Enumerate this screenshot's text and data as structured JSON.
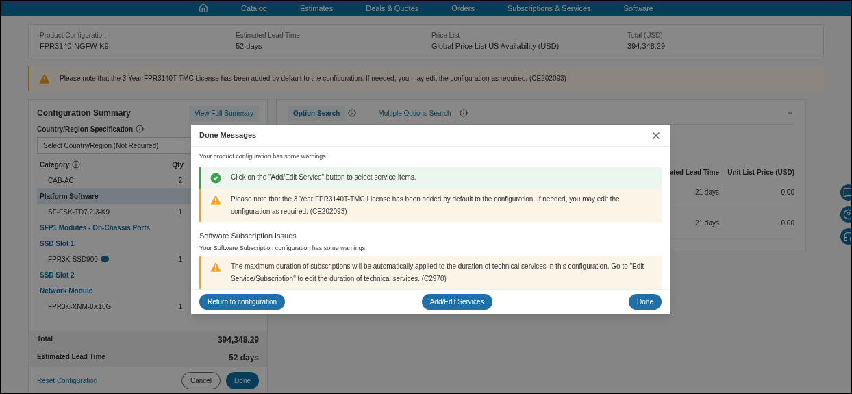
{
  "nav": {
    "items": [
      {
        "kind": "home"
      },
      {
        "kind": "text",
        "label": "Catalog"
      },
      {
        "kind": "text",
        "label": "Estimates"
      },
      {
        "kind": "text",
        "label": "Deals & Quotes"
      },
      {
        "kind": "text",
        "label": "Orders"
      },
      {
        "kind": "text",
        "label": "Subscriptions & Services"
      },
      {
        "kind": "text",
        "label": "Software"
      }
    ]
  },
  "summary_fields": [
    {
      "label": "Product Configuration",
      "value": "FPR3140-NGFW-K9"
    },
    {
      "label": "Estimated Lead Time",
      "value": "52 days"
    },
    {
      "label": "Price List",
      "value": "Global Price List US Availability (USD)"
    },
    {
      "label": "Total (USD)",
      "value": "394,348.29"
    }
  ],
  "banner": {
    "kind": "warning",
    "text": "Please note that the 3 Year FPR3140T-TMC License has been added by default to the configuration. If needed, you may edit the configuration as required. (CE202093)"
  },
  "config_summary": {
    "title": "Configuration Summary",
    "view_link": "View Full Summary",
    "region_label": "Country/Region Specification",
    "region_select": "Select Country/Region (Not Required)",
    "category_header": "Category",
    "qty_header": "Qty",
    "rows": [
      {
        "kind": "item",
        "name": "CAB-AC",
        "qty": "2",
        "badge": false
      },
      {
        "kind": "heading",
        "name": "Platform Software",
        "selected": true
      },
      {
        "kind": "item",
        "name": "SF-FSK-TD7.2.3-K9",
        "qty": "1",
        "badge": false
      },
      {
        "kind": "link",
        "name": "SFP1 Modules - On-Chassis Ports"
      },
      {
        "kind": "link",
        "name": "SSD Slot 1"
      },
      {
        "kind": "item",
        "name": "FPR3K-SSD900",
        "qty": "1",
        "badge": true
      },
      {
        "kind": "link",
        "name": "SSD Slot 2"
      },
      {
        "kind": "link",
        "name": "Network Module"
      },
      {
        "kind": "item",
        "name": "FPR3K-XNM-8X10G",
        "qty": "1",
        "badge": false
      }
    ],
    "total_label": "Total",
    "total_value": "394,348.29",
    "lead_label": "Estimated Lead Time",
    "lead_value": "52 days",
    "reset_link": "Reset Configuration",
    "cancel_button": "Cancel",
    "done_button": "Done"
  },
  "options": {
    "tabs": [
      {
        "label": "Option Search",
        "selected": true
      },
      {
        "label": "Multiple Options Search",
        "selected": false
      }
    ],
    "columns": [
      "ated Lead Time",
      "Unit List Price (USD)"
    ],
    "rows": [
      [
        "21 days",
        "0.00"
      ],
      [
        "21 days",
        "0.00"
      ]
    ]
  },
  "side_buttons": [
    {
      "kind": "chat"
    },
    {
      "kind": "help"
    },
    {
      "kind": "feedback"
    }
  ],
  "dialog": {
    "title": "Done Messages",
    "intro": "Your product configuration has some warnings.",
    "messages": [
      {
        "kind": "success",
        "text": "Click on the \"Add/Edit Service\" button to select service items."
      },
      {
        "kind": "warning",
        "text": "Please note that the 3 Year FPR3140T-TMC License has been added by default to the configuration. If needed, you may edit the configuration as required. (CE202093)"
      }
    ],
    "section_title": "Software Subscription Issues",
    "section_intro": "Your Software Subscription configuration has some warnings.",
    "section_messages": [
      {
        "kind": "warning",
        "text": "The maximum duration of subscriptions will be automatically applied to the duration of technical services in this configuration. Go to \"Edit Service/Subscription\" to edit the duration of technical services. (C2970)"
      }
    ],
    "buttons": [
      "Return to configuration",
      "Add/Edit Services",
      "Done"
    ]
  }
}
